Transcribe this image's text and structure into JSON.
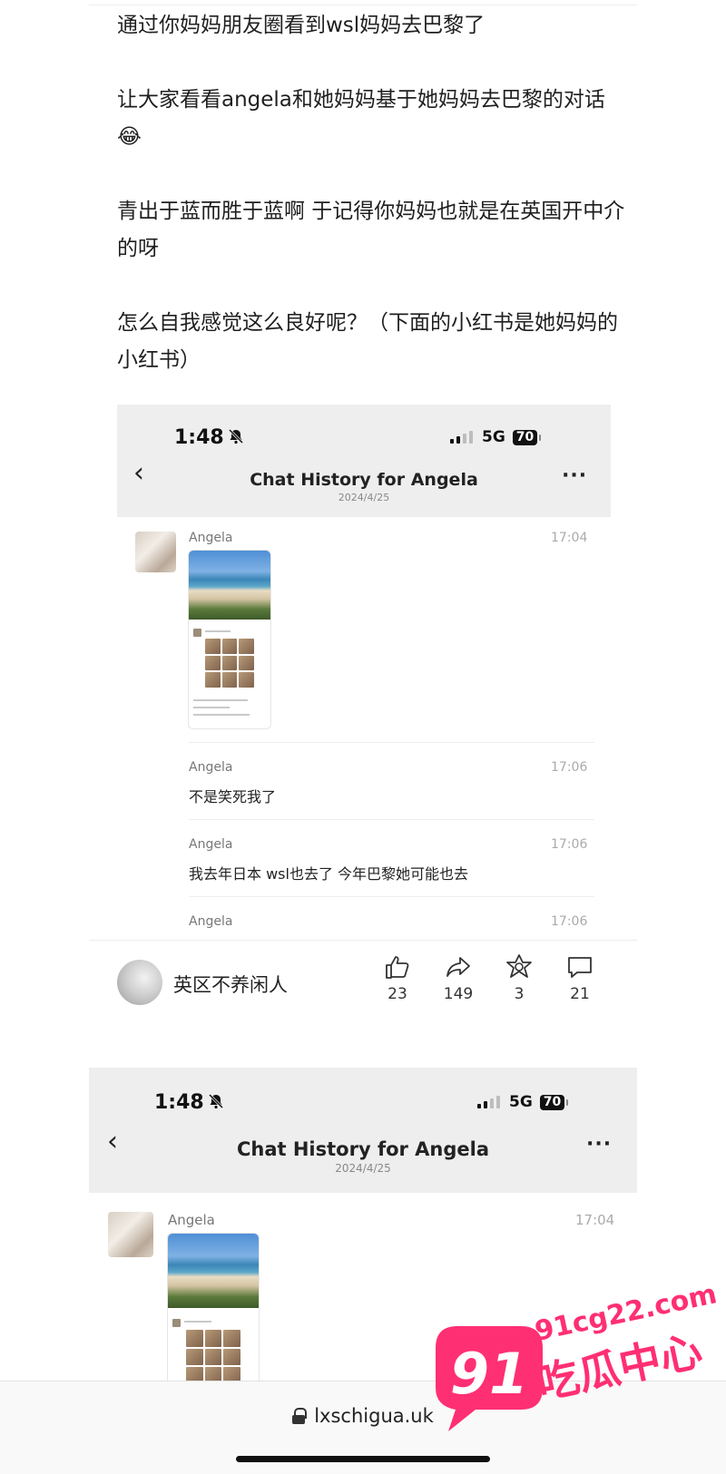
{
  "post": {
    "paragraphs": [
      "通过你妈妈朋友圈看到wsl妈妈去巴黎了",
      "让大家看看angela和她妈妈基于她妈妈去巴黎的对话😂",
      "青出于蓝而胜于蓝啊 于记得你妈妈也就是在英国开中介的呀",
      "怎么自我感觉这么良好呢？（下面的小红书是她妈妈的小红书）"
    ]
  },
  "shot1": {
    "time": "1:48",
    "network": "5G",
    "battery": "70",
    "title": "Chat History for Angela",
    "date": "2024/4/25",
    "messages": [
      {
        "sender": "Angela",
        "time": "17:04",
        "text": ""
      },
      {
        "sender": "Angela",
        "time": "17:06",
        "text": "不是笑死我了"
      },
      {
        "sender": "Angela",
        "time": "17:06",
        "text": "我去年日本 wsl也去了 今年巴黎她可能也去"
      },
      {
        "sender": "Angela",
        "time": "17:06",
        "text": ""
      }
    ]
  },
  "author": {
    "name": "英区不养闲人"
  },
  "actions": {
    "like": "23",
    "share": "149",
    "star": "3",
    "comment": "21"
  },
  "shot2": {
    "time": "1:48",
    "network": "5G",
    "battery": "70",
    "title": "Chat History for Angela",
    "date": "2024/4/25",
    "messages": [
      {
        "sender": "Angela",
        "time": "17:04"
      }
    ]
  },
  "browser": {
    "url": "lxschigua.uk"
  },
  "watermark": {
    "number": "91",
    "site": "91cg22.com",
    "name": "吃瓜中心",
    "color": "#ff2f73"
  }
}
